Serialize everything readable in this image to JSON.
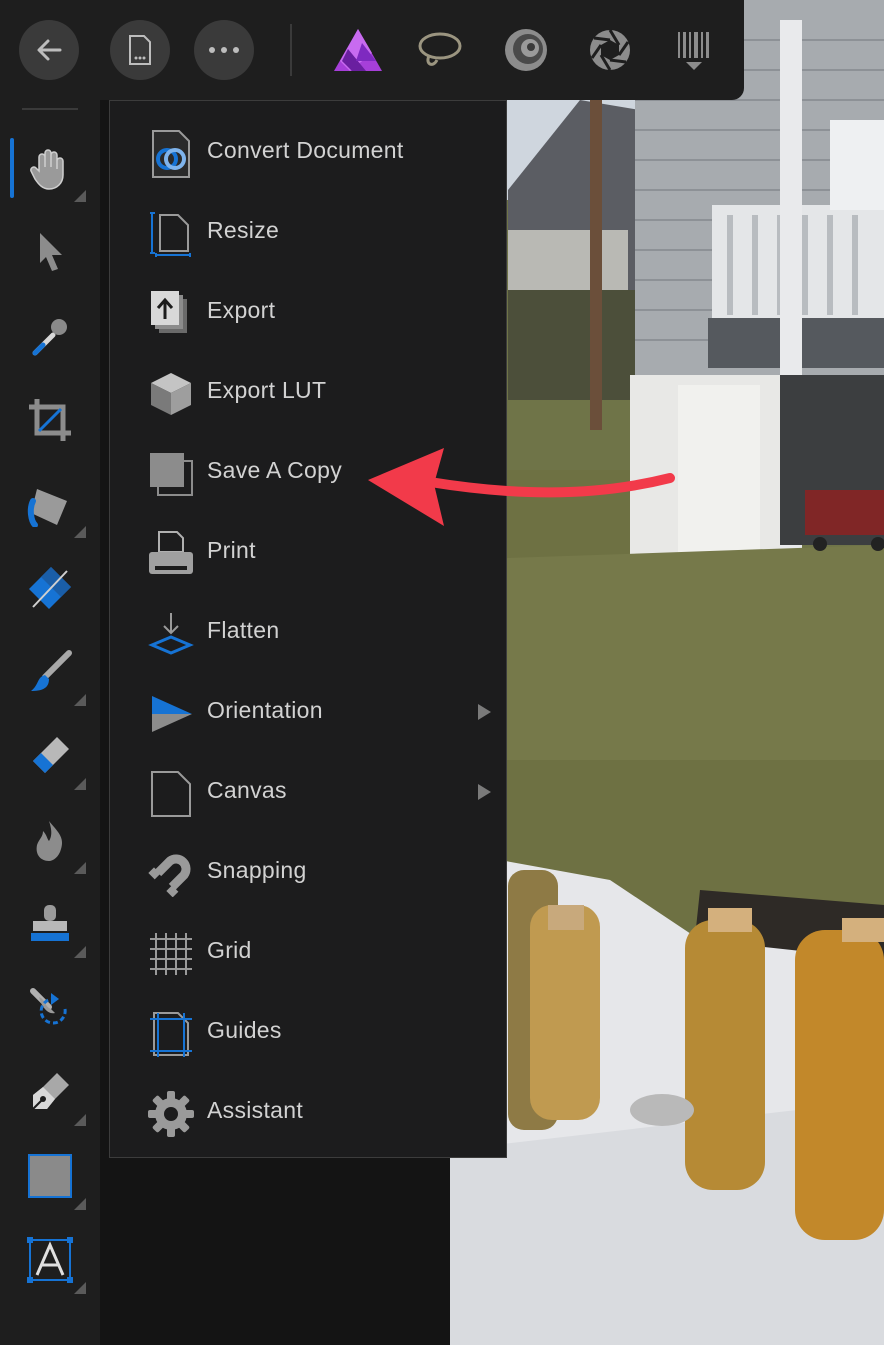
{
  "colors": {
    "accent": "#1673d4",
    "annotation_arrow": "#f23a4a",
    "affinity_purple": "#a63fd9"
  },
  "toolbar": {
    "buttons": [
      {
        "name": "back-button",
        "icon": "back-arrow-icon"
      },
      {
        "name": "document-button",
        "icon": "document-icon"
      },
      {
        "name": "more-button",
        "icon": "ellipsis-icon"
      }
    ],
    "personas": [
      {
        "name": "photo-persona",
        "icon": "affinity-photo-icon"
      },
      {
        "name": "liquify-persona",
        "icon": "lasso-icon"
      },
      {
        "name": "develop-persona",
        "icon": "develop-spiral-icon"
      },
      {
        "name": "tone-mapping-persona",
        "icon": "aperture-icon"
      },
      {
        "name": "export-persona",
        "icon": "export-barcode-icon"
      }
    ]
  },
  "tools": [
    "hand-tool-icon",
    "move-tool-icon",
    "color-picker-icon",
    "crop-tool-icon",
    "flood-fill-icon",
    "gradient-tool-icon",
    "paint-brush-icon",
    "eraser-icon",
    "burn-tool-icon",
    "clone-stamp-icon",
    "undo-brush-icon",
    "pen-tool-icon",
    "rectangle-tool-icon",
    "text-tool-icon"
  ],
  "menu": {
    "items": [
      {
        "label": "Convert Document",
        "icon": "convert-document-icon",
        "submenu": false
      },
      {
        "label": "Resize",
        "icon": "resize-icon",
        "submenu": false
      },
      {
        "label": "Export",
        "icon": "export-icon",
        "submenu": false
      },
      {
        "label": "Export LUT",
        "icon": "lut-cube-icon",
        "submenu": false
      },
      {
        "label": "Save A Copy",
        "icon": "save-copy-icon",
        "submenu": false
      },
      {
        "label": "Print",
        "icon": "printer-icon",
        "submenu": false
      },
      {
        "label": "Flatten",
        "icon": "flatten-icon",
        "submenu": false
      },
      {
        "label": "Orientation",
        "icon": "orientation-icon",
        "submenu": true
      },
      {
        "label": "Canvas",
        "icon": "canvas-icon",
        "submenu": true
      },
      {
        "label": "Snapping",
        "icon": "magnet-icon",
        "submenu": false
      },
      {
        "label": "Grid",
        "icon": "grid-icon",
        "submenu": false
      },
      {
        "label": "Guides",
        "icon": "guides-icon",
        "submenu": false
      },
      {
        "label": "Assistant",
        "icon": "gear-icon",
        "submenu": false
      }
    ]
  }
}
